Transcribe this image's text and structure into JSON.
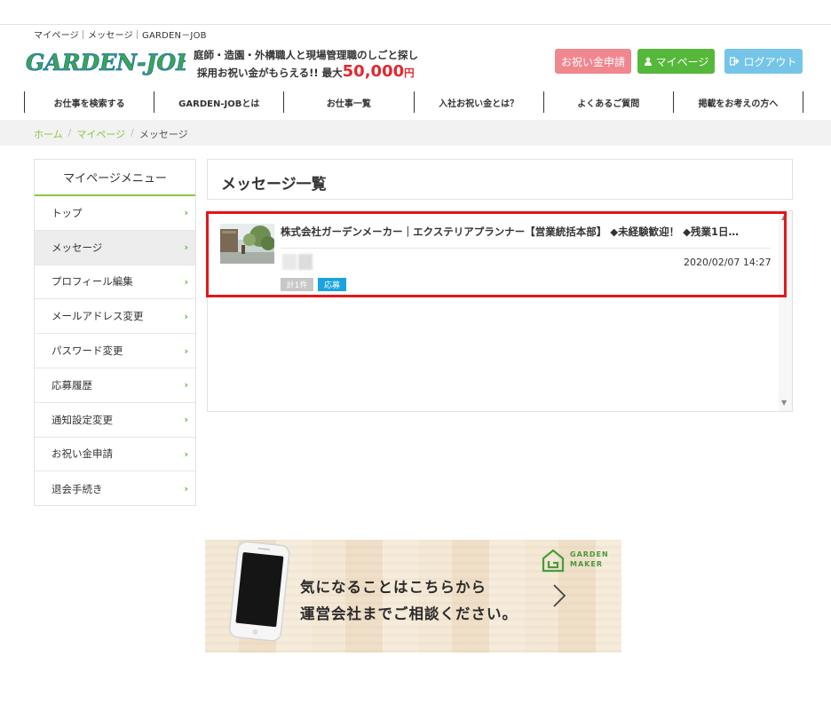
{
  "header": {
    "breadcrumb_text": "マイページ｜メッセージ｜GARDEN－JOB",
    "logo_text": "GARDEN-JOB",
    "tagline_line1": "庭師・造園・外構職人と現場管理職のしごと探し",
    "tagline_prefix": "採用お祝い金がもらえる!! 最大",
    "tagline_amount": "50,000",
    "tagline_suffix": "円",
    "buttons": {
      "celebration": "お祝い金申請",
      "mypage": "マイページ",
      "logout": "ログアウト"
    },
    "colors": {
      "brand_green": "#56b83a",
      "pink": "#f0868e",
      "light_blue": "#74c5e8",
      "accent_red": "#e0282d"
    }
  },
  "nav": {
    "items": [
      "お仕事を検索する",
      "GARDEN-JOBとは",
      "お仕事一覧",
      "入社お祝い金とは？",
      "よくあるご質問",
      "掲載をお考えの方へ"
    ]
  },
  "breadcrumb": {
    "home": "ホーム",
    "mypage": "マイページ",
    "current": "メッセージ",
    "separator": "/"
  },
  "sidebar": {
    "title": "マイページメニュー",
    "items": [
      {
        "label": "トップ",
        "active": false
      },
      {
        "label": "メッセージ",
        "active": true
      },
      {
        "label": "プロフィール編集",
        "active": false
      },
      {
        "label": "メールアドレス変更",
        "active": false
      },
      {
        "label": "パスワード変更",
        "active": false
      },
      {
        "label": "応募履歴",
        "active": false
      },
      {
        "label": "通知設定変更",
        "active": false
      },
      {
        "label": "お祝い金申請",
        "active": false
      },
      {
        "label": "退会手続き",
        "active": false
      }
    ]
  },
  "main": {
    "title": "メッセージ一覧",
    "messages": [
      {
        "title": "株式会社ガーデンメーカー｜エクステリアプランナー【営業統括本部】 ◆未経験歓迎！ ◆残業1日…",
        "date": "2020/02/07 14:27",
        "count_tag": "計1件",
        "type_tag": "応募"
      }
    ]
  },
  "banner": {
    "line1": "気になることはこちらから",
    "line2": "運営会社までご相談ください。",
    "logo_line1": "GARDEN",
    "logo_line2": "MAKER"
  }
}
